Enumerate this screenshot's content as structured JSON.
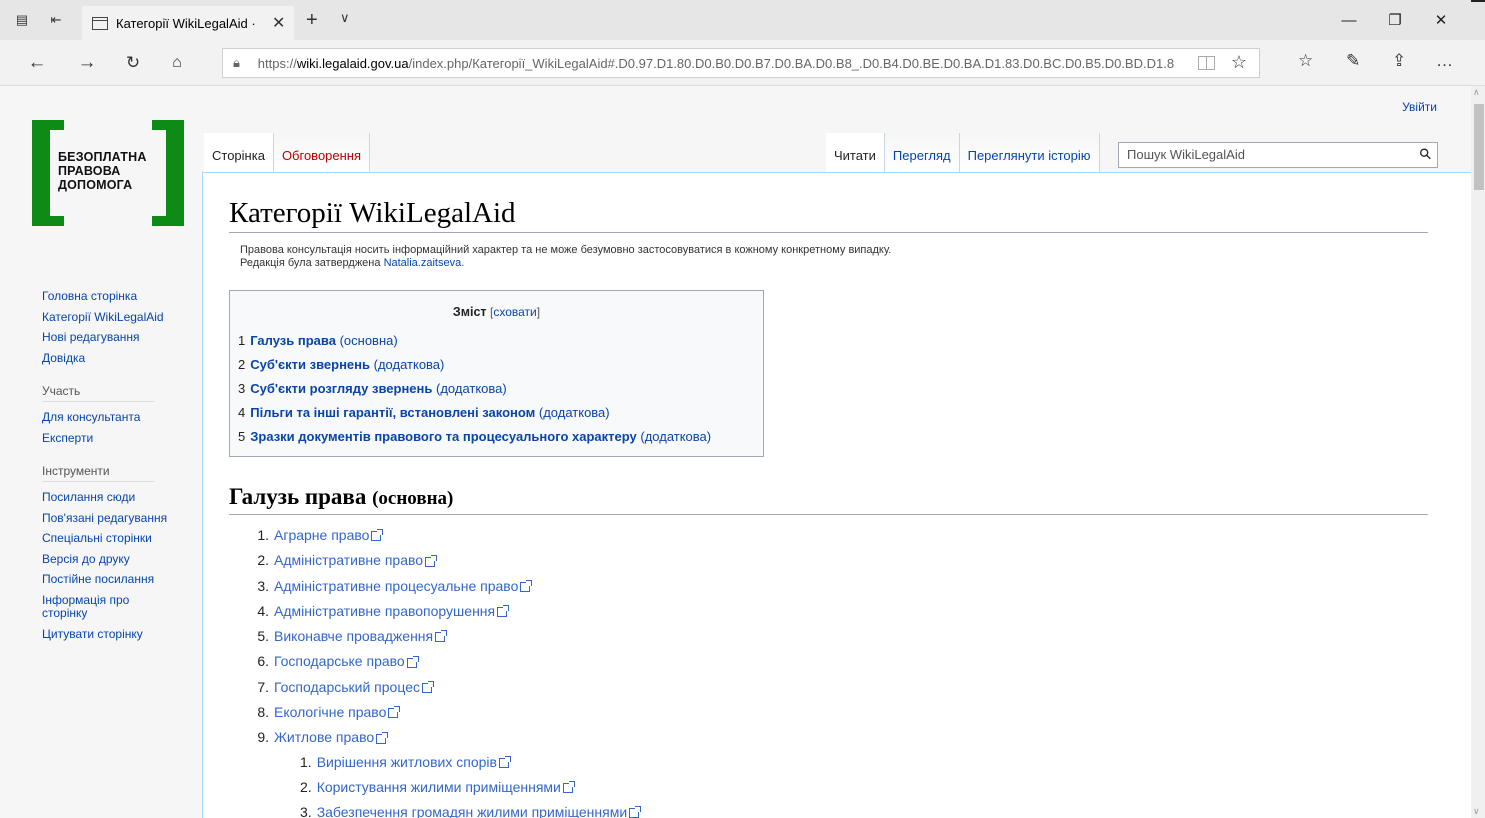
{
  "browser": {
    "tab_title": "Категорії WikiLegalAid ·",
    "url_scheme": "https://",
    "url_host": "wiki.legalaid.gov.ua",
    "url_path": "/index.php/Категорії_WikiLegalAid#.D0.97.D1.80.D0.B0.D0.B7.D0.BA.D0.B8_.D0.B4.D0.BE.D0.BA.D1.83.D0.BC.D0.B5.D0.BD.D1.8"
  },
  "page": {
    "login": "Увійти",
    "logo_text": "БЕЗОПЛАТНА ПРАВОВА ДОПОМОГА",
    "tabs_left": [
      "Сторінка",
      "Обговорення"
    ],
    "tabs_right": [
      "Читати",
      "Перегляд",
      "Переглянути історію"
    ],
    "search_placeholder": "Пошук WikiLegalAid",
    "title": "Категорії WikiLegalAid",
    "notice_line1": "Правова консультація носить інформаційний характер та не може безумовно застосовуватися в кожному конкретному випадку.",
    "notice_prefix": "Редакція була затверджена ",
    "notice_user": "Natalia.zaitseva",
    "notice_suffix": "."
  },
  "sidebar": {
    "nav": [
      "Головна сторінка",
      "Категорії WikiLegalAid",
      "Нові редагування",
      "Довідка"
    ],
    "participation_heading": "Участь",
    "participation": [
      "Для консультанта",
      "Експерти"
    ],
    "tools_heading": "Інструменти",
    "tools": [
      "Посилання сюди",
      "Пов'язані редагування",
      "Спеціальні сторінки",
      "Версія до друку",
      "Постійне посилання",
      "Інформація про сторінку",
      "Цитувати сторінку"
    ]
  },
  "toc": {
    "title": "Зміст",
    "toggle": "сховати",
    "items": [
      {
        "num": "1",
        "main": "Галузь права",
        "sub": "(основна)"
      },
      {
        "num": "2",
        "main": "Суб'єкти звернень",
        "sub": "(додаткова)"
      },
      {
        "num": "3",
        "main": "Суб'єкти розгляду звернень",
        "sub": "(додаткова)"
      },
      {
        "num": "4",
        "main": "Пільги та інші гарантії, встановлені законом",
        "sub": "(додаткова)"
      },
      {
        "num": "5",
        "main": "Зразки документів правового та процесуального характеру",
        "sub": "(додаткова)"
      }
    ]
  },
  "section": {
    "heading_main": "Галузь права",
    "heading_sub": "(основна)",
    "items": [
      "Аграрне право",
      "Адміністративне право",
      "Адміністративне процесуальне право",
      "Адміністративне правопорушення",
      "Виконавче провадження",
      "Господарське право",
      "Господарський процес",
      "Екологічне право",
      "Житлове право"
    ],
    "sub_items": [
      "Вирішення житлових спорів",
      "Користування жилими приміщеннями",
      "Забезпечення громадян жилими приміщеннями"
    ]
  }
}
